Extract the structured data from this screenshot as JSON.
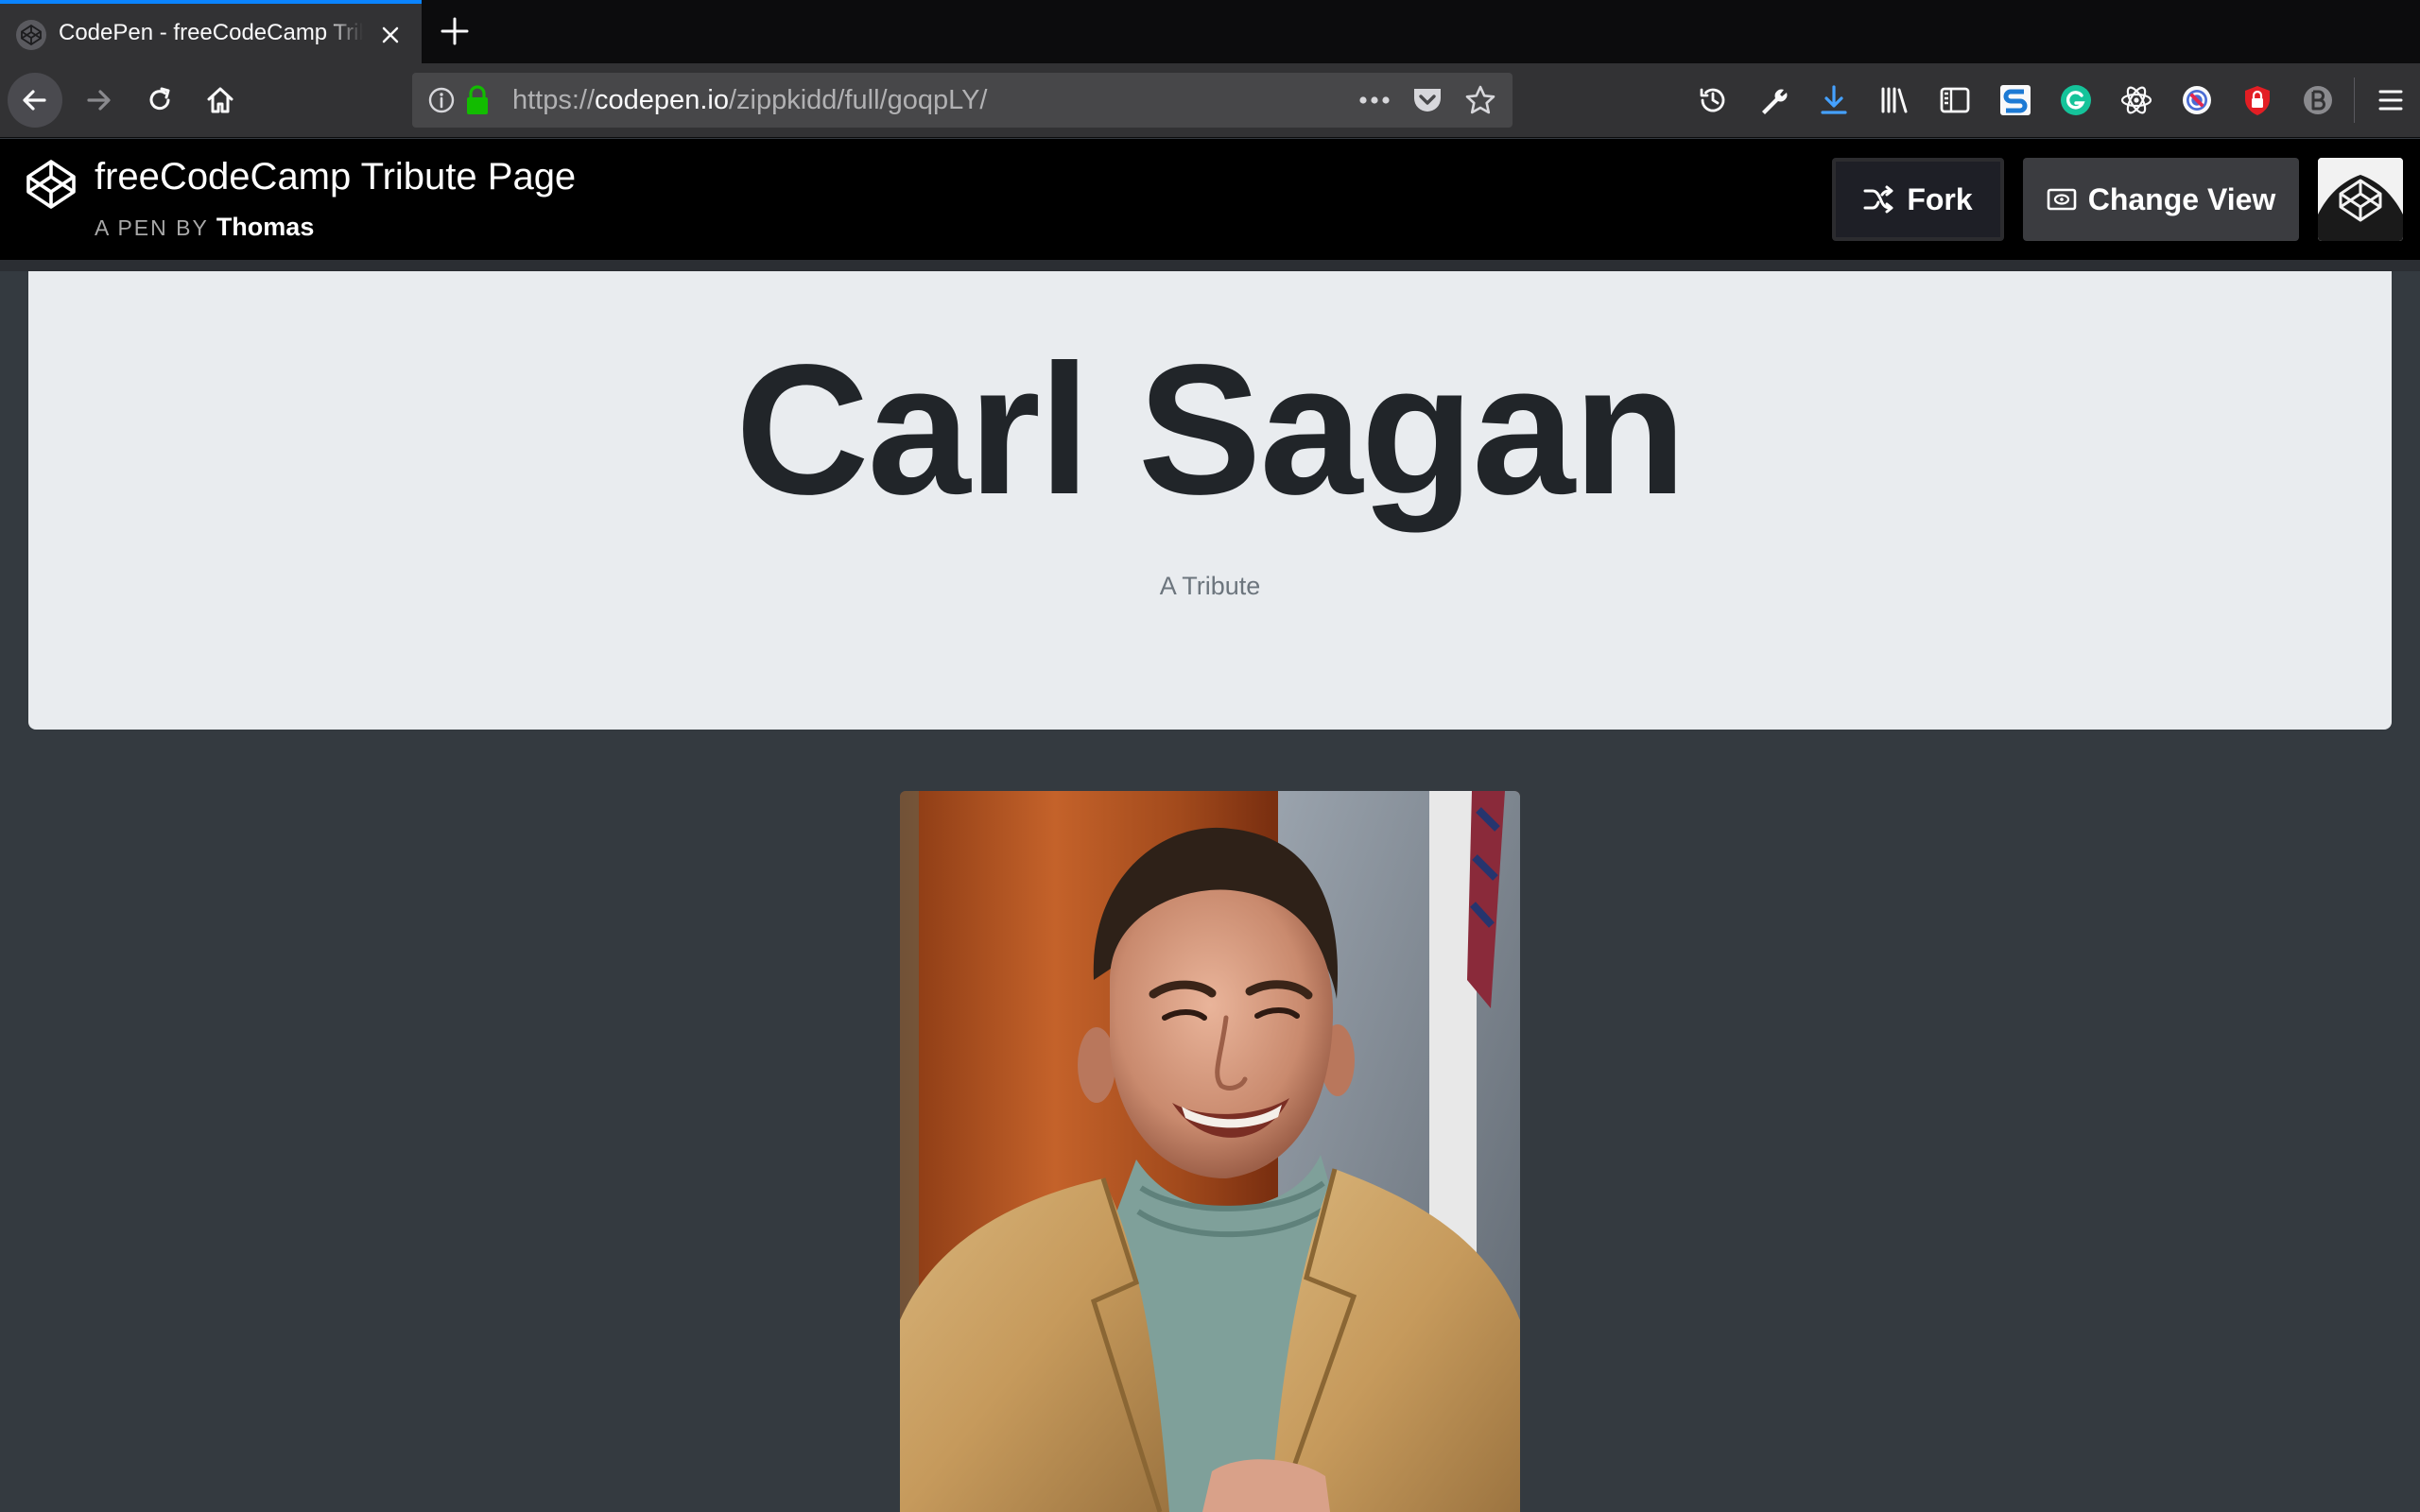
{
  "browser": {
    "tab": {
      "title": "CodePen - freeCodeCamp Tribute Page"
    },
    "url": {
      "scheme": "https://",
      "host": "codepen.io",
      "path": "/zippkidd/full/goqpLY/"
    }
  },
  "codepen": {
    "pen_title": "freeCodeCamp Tribute Page",
    "byline_prefix": "A PEN BY",
    "author": "Thomas",
    "fork_label": "Fork",
    "change_view_label": "Change View"
  },
  "page": {
    "title": "Carl Sagan",
    "subtitle": "A Tribute"
  },
  "icons": {
    "tab_favicon": "codepen-icon",
    "tab_close": "close-icon",
    "new_tab": "plus-icon",
    "back": "arrow-left-icon",
    "forward": "arrow-right-icon",
    "reload": "reload-icon",
    "home": "home-icon",
    "site_info": "info-icon",
    "secure": "lock-icon",
    "page_actions": "more-icon",
    "pocket": "pocket-icon",
    "bookmark": "star-icon",
    "toolbar": [
      "history-icon",
      "wrench-icon",
      "download-icon",
      "library-icon",
      "sidebar-icon",
      "s-extension-icon",
      "grammarly-icon",
      "react-devtools-icon",
      "blocker-icon",
      "shield-icon",
      "b-extension-icon",
      "menu-icon"
    ]
  },
  "colors": {
    "tab_accent": "#0a84ff",
    "download_blue": "#45a1ff",
    "lock_green": "#12bc00",
    "jumbotron_bg": "#e9ecef",
    "page_bg": "#343a40"
  }
}
